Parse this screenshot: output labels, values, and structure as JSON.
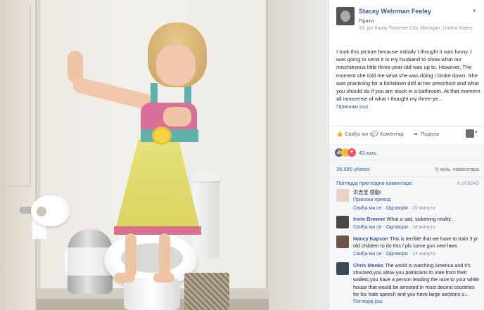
{
  "post": {
    "author": "Stacey Wehrman Feeley",
    "follow_label": "Прати",
    "meta": "16. јун близу Traverse City, Michigan, United States",
    "body": "I took this picture because initially I thought it was funny. I was going to send it to my husband to show what our mischievous little three-year-old was up to. However, The moment she told me what she was doing I broke down. She was practicing for a lockdown drill at her preschool and what you should do if you are stuck in a bathroom. At that moment all innocense of what I thought my three-ye...",
    "see_more": "Прикажи још"
  },
  "actions": {
    "like": "Свиђа ми се",
    "comment": "Коментар",
    "share": "Подели"
  },
  "reactions": {
    "count": "43 хиљ."
  },
  "stats": {
    "shares": "36.980 shares",
    "comments": "5 хиљ. коментара"
  },
  "comments_header": {
    "previous": "Погледај претходне коментаре",
    "count": "6 of 5042"
  },
  "comments": [
    {
      "name": "",
      "text": "洪志宝 感動!",
      "sub": "Прикажи превод",
      "like": "Свиђа ми се",
      "reply": "Одговори",
      "time": "20 минута"
    },
    {
      "name": "Irene Browne",
      "text": "What a sad, sickening reality...",
      "like": "Свиђа ми се",
      "reply": "Одговори",
      "time": "18 минута"
    },
    {
      "name": "Nancy Kapson",
      "text": "This is terrible that we have to train 3 yr old children to do this / pls some gun new laws",
      "like": "Свиђа ми се",
      "reply": "Одговори",
      "time": "14 минута"
    },
    {
      "name": "Chris Monks",
      "text": "The world is watching America and it's shocked,you allow you politicians to vote from their wallets,you have a person leading the race to your white house that would be arrested in most decent countries for his hate speech and you have large sections o...",
      "more": "Погледај још"
    }
  ],
  "icons": {
    "like": "thumbs-up-icon",
    "comment": "speech-bubble-icon",
    "share": "share-arrow-icon",
    "options": "chevron-down-icon"
  },
  "colors": {
    "link": "#365899",
    "muted": "#90949c",
    "panel_bg": "#f6f7f9"
  }
}
